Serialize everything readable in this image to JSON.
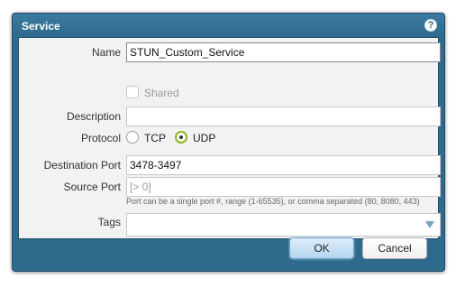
{
  "dialog": {
    "title": "Service",
    "help_icon": "?",
    "help_icon_name": "help-icon"
  },
  "form": {
    "name_label": "Name",
    "name_value": "STUN_Custom_Service",
    "shared_label": "Shared",
    "shared_checked": false,
    "description_label": "Description",
    "description_value": "",
    "protocol_label": "Protocol",
    "protocol_options": [
      "TCP",
      "UDP"
    ],
    "protocol_selected": "UDP",
    "destination_port_label": "Destination Port",
    "destination_port_value": "3478-3497",
    "source_port_label": "Source Port",
    "source_port_placeholder": "[> 0]",
    "port_hint": "Port can be a single port #, range (1-65535), or comma separated (80, 8080, 443)",
    "tags_label": "Tags",
    "tags_value": ""
  },
  "buttons": {
    "ok": "OK",
    "cancel": "Cancel"
  },
  "colors": {
    "frame": "#2e6a8c",
    "panel": "#f2f2f2",
    "radio_selected": "#8ab823"
  }
}
